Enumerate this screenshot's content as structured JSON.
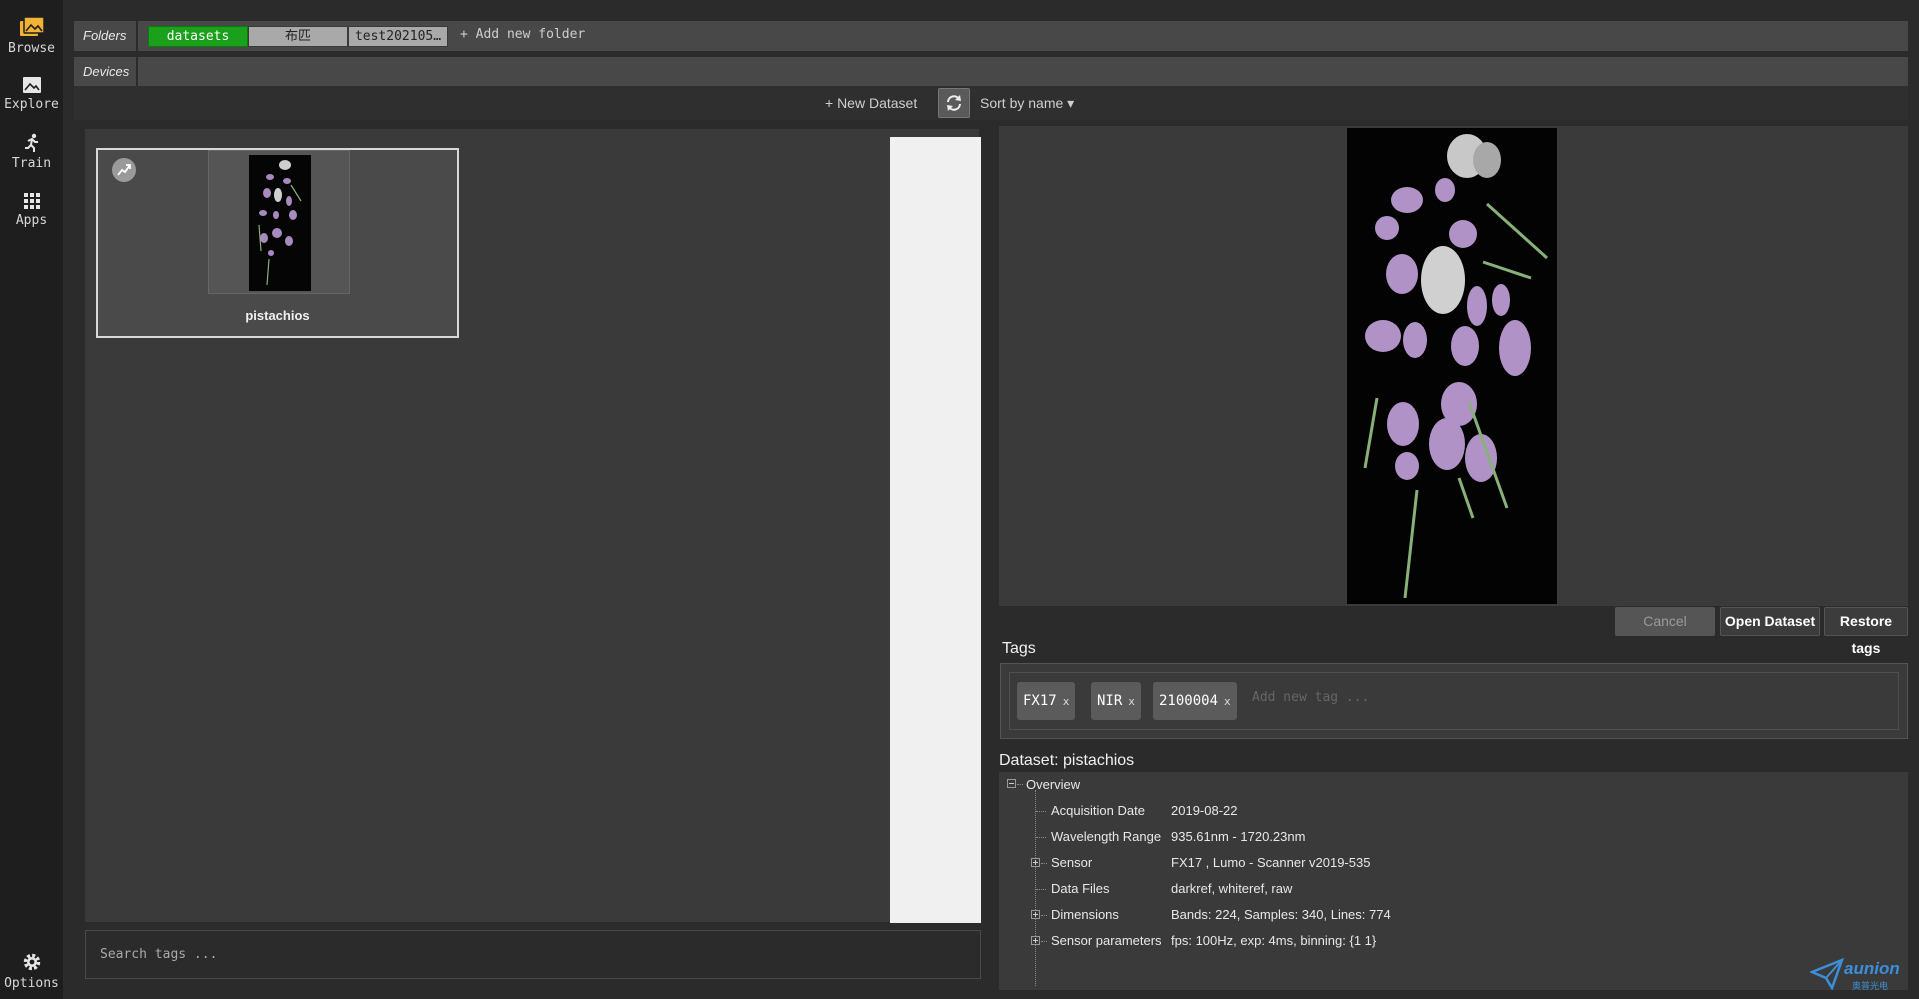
{
  "nav": {
    "browse": "Browse",
    "explore": "Explore",
    "train": "Train",
    "apps": "Apps",
    "options": "Options"
  },
  "header": {
    "folders_label": "Folders",
    "devices_label": "Devices",
    "folders": [
      "datasets",
      "布匹",
      "test202105…"
    ],
    "add_folder": "+ Add new folder"
  },
  "toolbar": {
    "new_dataset": "+ New Dataset",
    "sort": "Sort by name ▾"
  },
  "datasets": [
    {
      "name": "pistachios"
    }
  ],
  "search": {
    "placeholder": "Search tags ..."
  },
  "actions": {
    "cancel": "Cancel",
    "open": "Open Dataset",
    "restore": "Restore tags"
  },
  "tags": {
    "title": "Tags",
    "items": [
      "FX17",
      "NIR",
      "2100004"
    ],
    "remove_glyph": "x",
    "placeholder": "Add new tag ..."
  },
  "dataset_info": {
    "title": "Dataset: pistachios",
    "overview": "Overview",
    "rows": [
      {
        "key": "Acquisition Date",
        "value": "2019-08-22"
      },
      {
        "key": "Wavelength Range",
        "value": "935.61nm - 1720.23nm"
      },
      {
        "key": "Sensor",
        "value": "FX17 , Lumo - Scanner v2019-535"
      },
      {
        "key": "Data Files",
        "value": "darkref, whiteref, raw"
      },
      {
        "key": "Dimensions",
        "value": "Bands: 224, Samples: 340, Lines: 774"
      },
      {
        "key": "Sensor parameters",
        "value": "fps: 100Hz, exp: 4ms, binning: {1 1}"
      }
    ]
  },
  "brand": {
    "name": "aunion",
    "sub": "奥普光电"
  },
  "colors": {
    "active_folder": "#1aa01a",
    "brand": "#3b8fd8",
    "accent_icon": "#f2b233"
  }
}
